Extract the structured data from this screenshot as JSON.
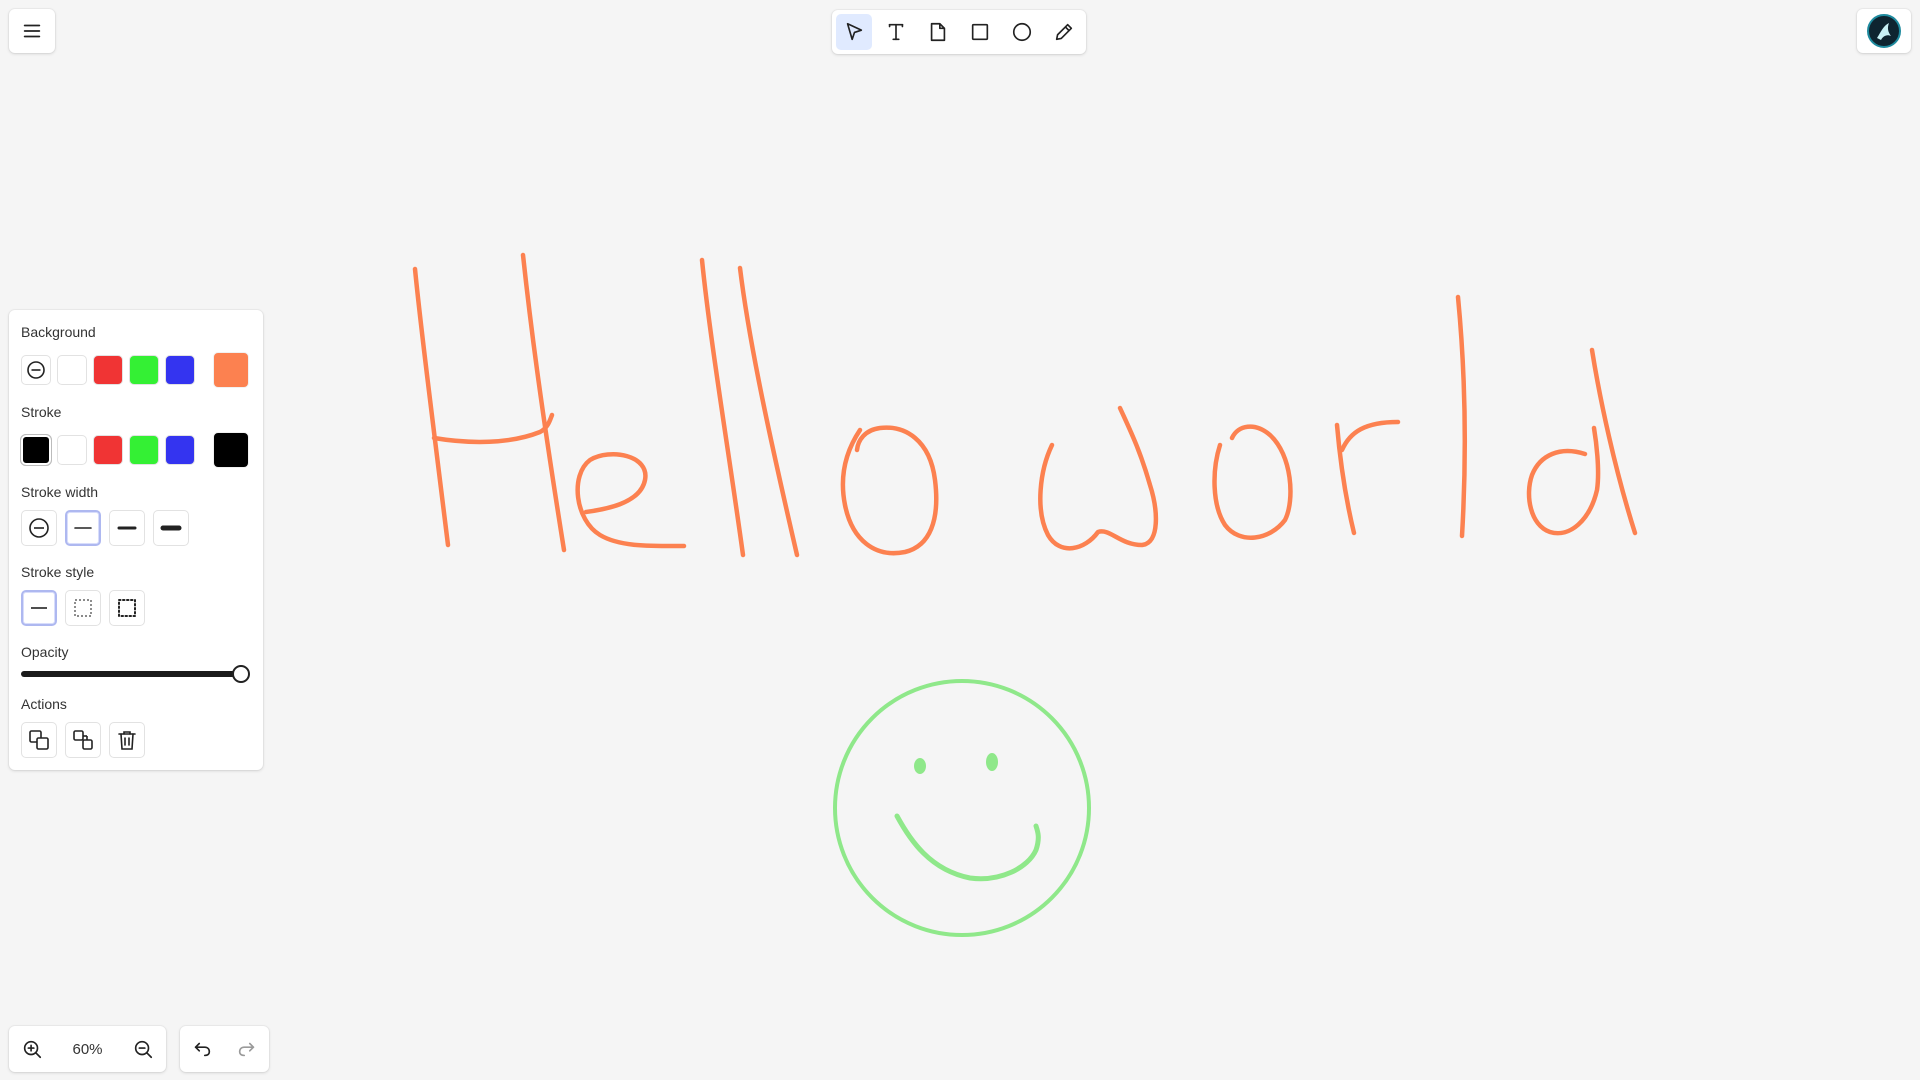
{
  "toolbar": {
    "tools": [
      {
        "name": "select",
        "icon": "cursor-arrow-icon",
        "active": true
      },
      {
        "name": "text",
        "icon": "text-icon",
        "active": false
      },
      {
        "name": "sticky-note",
        "icon": "note-icon",
        "active": false
      },
      {
        "name": "rectangle",
        "icon": "square-icon",
        "active": false
      },
      {
        "name": "ellipse",
        "icon": "circle-icon",
        "active": false
      },
      {
        "name": "draw",
        "icon": "pencil-icon",
        "active": false
      }
    ]
  },
  "properties": {
    "background_label": "Background",
    "background_swatches": [
      "none",
      "#ffffff",
      "#f03434",
      "#34f034",
      "#3434f0"
    ],
    "background_current": "#fc8150",
    "stroke_label": "Stroke",
    "stroke_swatches": [
      "#000000",
      "#ffffff",
      "#f03434",
      "#34f034",
      "#3434f0"
    ],
    "stroke_current": "#000000",
    "stroke_width_label": "Stroke width",
    "stroke_widths": [
      "none",
      "thin",
      "medium",
      "thick"
    ],
    "stroke_width_selected": "thin",
    "stroke_style_label": "Stroke style",
    "stroke_styles": [
      "solid",
      "dashed",
      "dotted"
    ],
    "stroke_style_selected": "solid",
    "opacity_label": "Opacity",
    "opacity_value": 1.0,
    "actions_label": "Actions",
    "actions": [
      "bring-forward-icon",
      "send-backward-icon",
      "trash-icon"
    ]
  },
  "zoom": {
    "level": "60%"
  },
  "canvas": {
    "stroke_color_text": "#fc8150",
    "stroke_color_smiley": "#8fe88a"
  }
}
